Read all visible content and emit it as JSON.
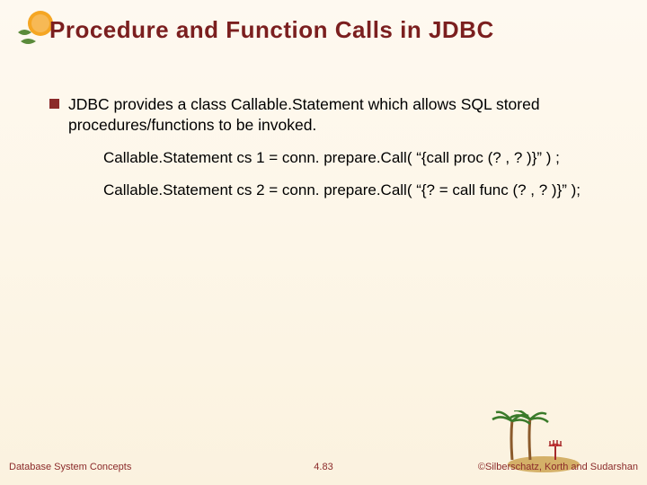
{
  "title": "Procedure and Function Calls in JDBC",
  "bullet": {
    "text": "JDBC provides a class Callable.Statement which allows SQL stored procedures/functions to be invoked."
  },
  "code": {
    "line1": "Callable.Statement cs 1 = conn. prepare.Call( “{call proc (? , ? )}” ) ;",
    "line2": "Callable.Statement cs 2 = conn. prepare.Call( “{? = call func (? , ? )}” );"
  },
  "footer": {
    "left": "Database System Concepts",
    "center": "4.83",
    "right": "©Silberschatz, Korth and Sudarshan"
  }
}
